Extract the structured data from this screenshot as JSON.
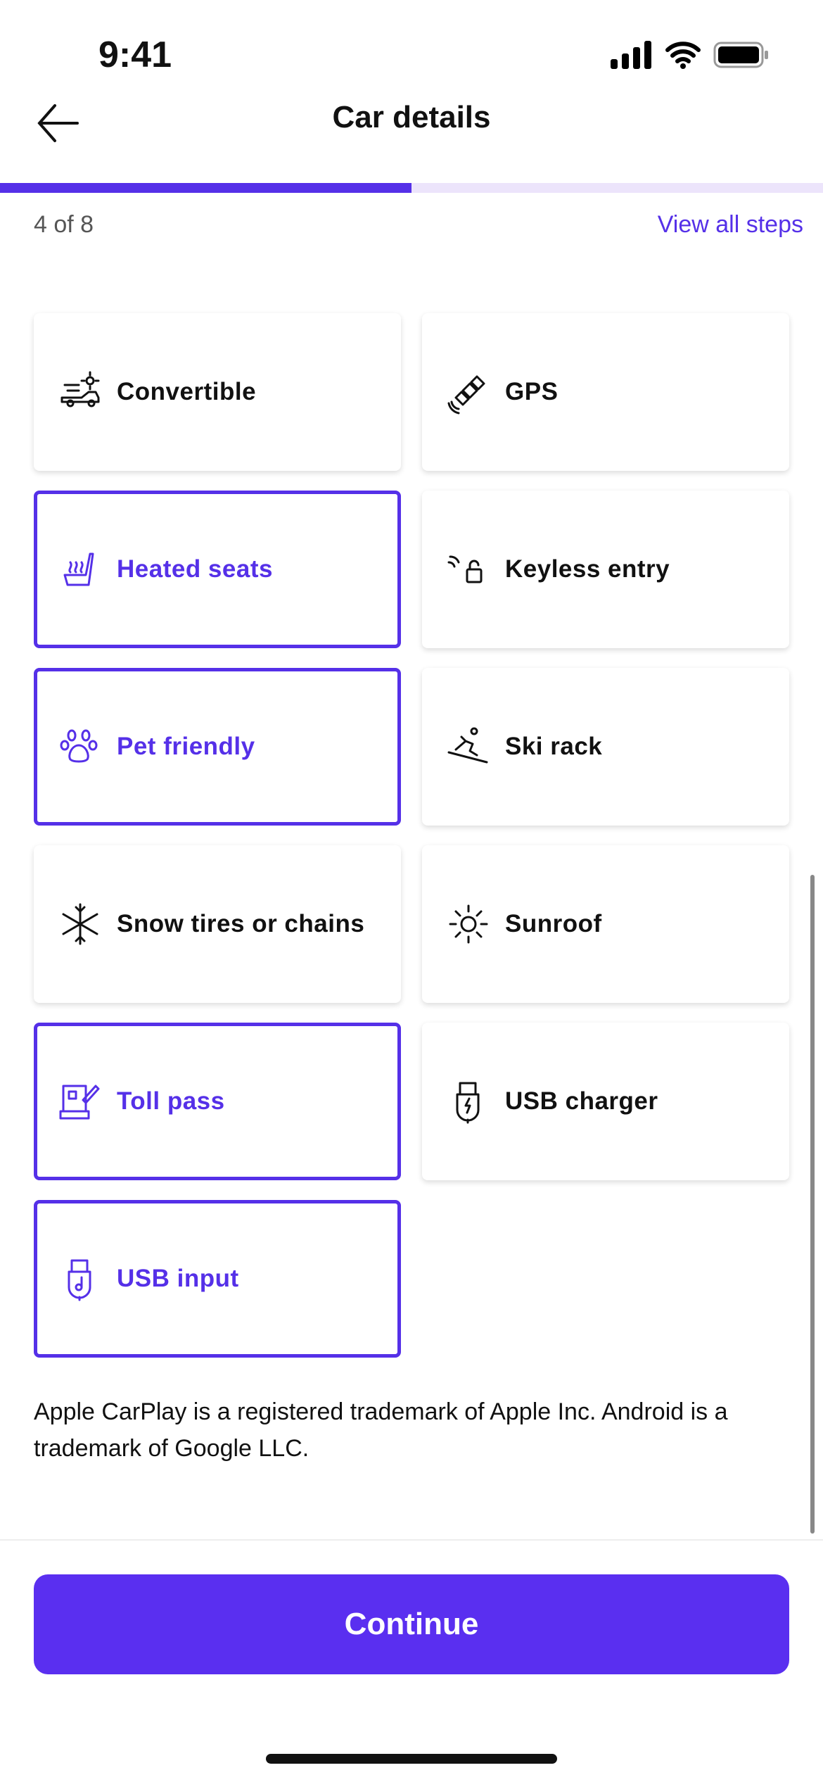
{
  "status_bar": {
    "time": "9:41",
    "icons": [
      "cellular-signal-icon",
      "wifi-icon",
      "battery-icon"
    ]
  },
  "header": {
    "title": "Car details",
    "back_icon": "arrow-left-icon"
  },
  "progress": {
    "current": 4,
    "total": 8,
    "fraction": 0.5,
    "label": "4 of 8",
    "view_all": "View all steps",
    "accent": "#5530e8"
  },
  "features": [
    {
      "label": "Convertible",
      "icon": "convertible-icon",
      "selected": false
    },
    {
      "label": "GPS",
      "icon": "satellite-icon",
      "selected": false
    },
    {
      "label": "Heated seats",
      "icon": "heated-seat-icon",
      "selected": true
    },
    {
      "label": "Keyless entry",
      "icon": "keyless-lock-icon",
      "selected": false
    },
    {
      "label": "Pet friendly",
      "icon": "paw-icon",
      "selected": true
    },
    {
      "label": "Ski rack",
      "icon": "skier-icon",
      "selected": false
    },
    {
      "label": "Snow tires or chains",
      "icon": "snowflake-icon",
      "selected": false
    },
    {
      "label": "Sunroof",
      "icon": "sun-icon",
      "selected": false
    },
    {
      "label": "Toll pass",
      "icon": "toll-pass-icon",
      "selected": true
    },
    {
      "label": "USB charger",
      "icon": "usb-charger-icon",
      "selected": false
    },
    {
      "label": "USB input",
      "icon": "usb-music-icon",
      "selected": true
    }
  ],
  "footnote": "Apple CarPlay is a registered trademark of Apple Inc. Android is a trademark of Google LLC.",
  "continue_label": "Continue"
}
